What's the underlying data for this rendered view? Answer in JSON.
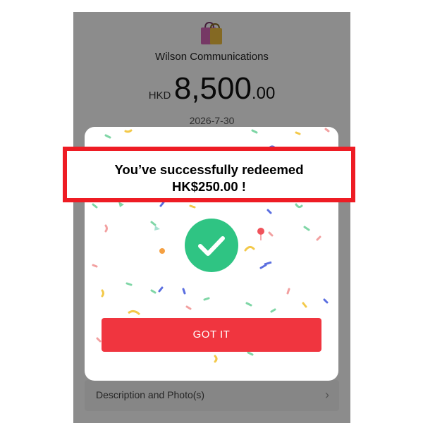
{
  "merchant": {
    "icon": "shopping-bags-icon",
    "name": "Wilson Communications"
  },
  "transaction": {
    "currency": "HKD",
    "amount_integer": "8,500",
    "amount_decimal": ".00",
    "date": "2026-7-30"
  },
  "details": {
    "description_label": "Description and Photo(s)",
    "chevron_icon": "chevron-right-icon"
  },
  "modal": {
    "message_line1": "You’ve successfully redeemed",
    "message_line2": "HK$250.00 !",
    "success_icon": "check-icon",
    "button_label": "GOT IT"
  },
  "colors": {
    "overlay": "#808080",
    "success_green": "#2fc483",
    "button_red": "#f0353f",
    "highlight_red": "#ee1c24"
  }
}
